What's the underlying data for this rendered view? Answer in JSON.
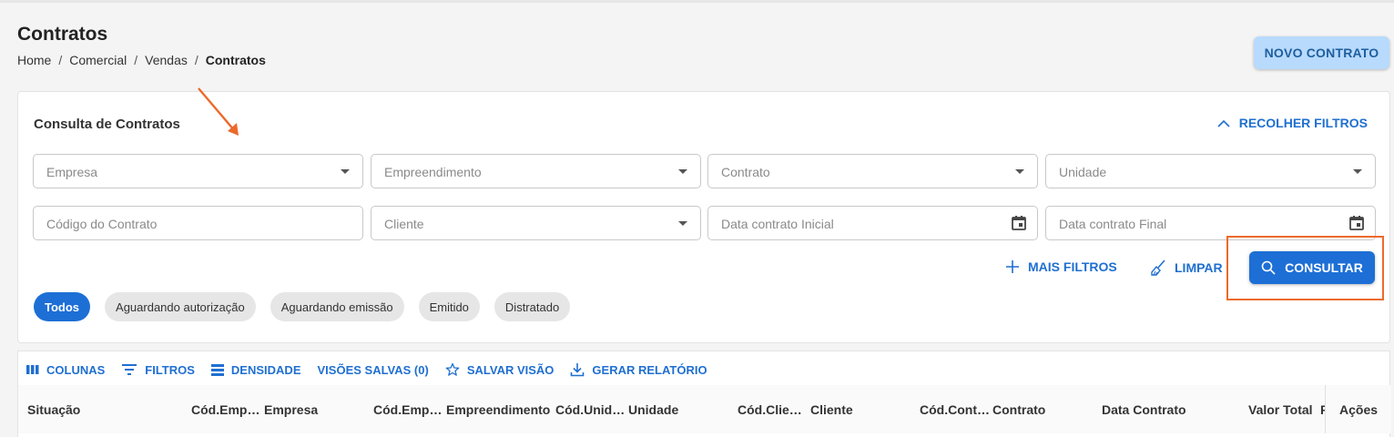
{
  "header": {
    "title": "Contratos",
    "breadcrumb": [
      "Home",
      "Comercial",
      "Vendas",
      "Contratos"
    ],
    "new_button": "NOVO CONTRATO"
  },
  "filters": {
    "title": "Consulta de Contratos",
    "collapse_label": "RECOLHER FILTROS",
    "fields": {
      "empresa": "Empresa",
      "empreendimento": "Empreendimento",
      "contrato": "Contrato",
      "unidade": "Unidade",
      "codigo_contrato": "Código do Contrato",
      "cliente": "Cliente",
      "data_inicial": "Data contrato Inicial",
      "data_final": "Data contrato Final"
    },
    "more_filters": "MAIS FILTROS",
    "clear": "LIMPAR",
    "consult": "CONSULTAR",
    "status_chips": [
      "Todos",
      "Aguardando autorização",
      "Aguardando emissão",
      "Emitido",
      "Distratado"
    ],
    "active_chip": "Todos"
  },
  "toolbar": {
    "columns": "COLUNAS",
    "filters": "FILTROS",
    "density": "DENSIDADE",
    "saved_views": "VISÕES SALVAS (0)",
    "save_view": "SALVAR VISÃO",
    "report": "GERAR RELATÓRIO"
  },
  "table": {
    "columns": [
      "Situação",
      "Cód.Emp…",
      "Empresa",
      "Cód.Emp…",
      "Empreendimento",
      "Cód.Unid…",
      "Unidade",
      "Cód.Clie…",
      "Cliente",
      "Cód.Cont…",
      "Contrato",
      "Data Contrato",
      "Valor Total",
      "F",
      "Ações"
    ]
  },
  "colors": {
    "primary": "#1d6fd6",
    "primary_light": "#b8dafc",
    "highlight": "#ec6a2c"
  }
}
